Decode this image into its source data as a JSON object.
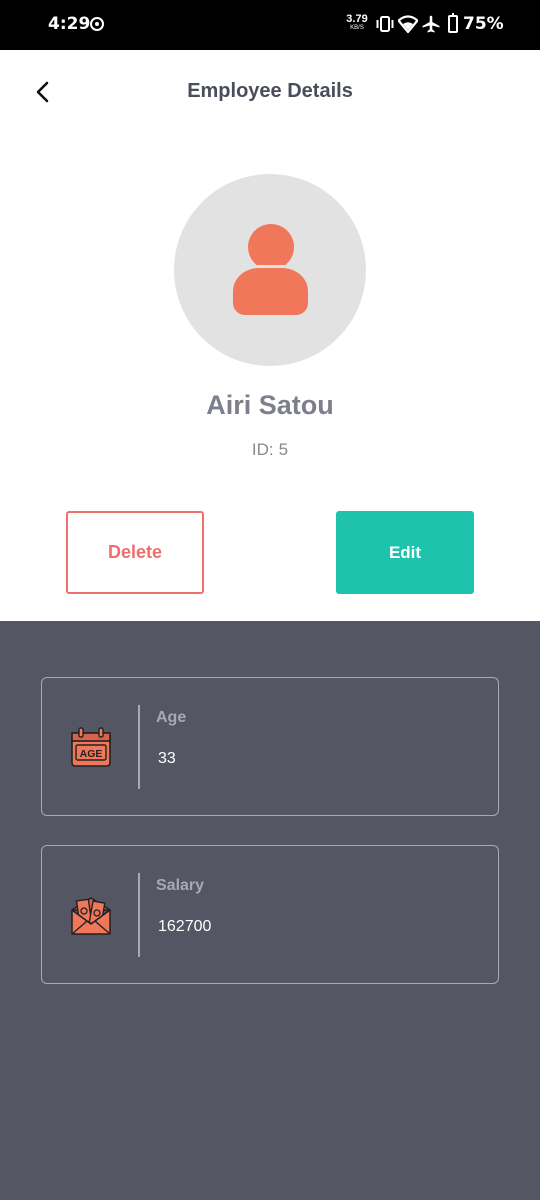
{
  "status_bar": {
    "time": "4:29",
    "net_speed_value": "3.79",
    "net_speed_unit": "KB/S",
    "battery": "75%"
  },
  "header": {
    "title": "Employee Details"
  },
  "employee": {
    "name": "Airi Satou",
    "id_prefix": "ID:",
    "id": "5"
  },
  "actions": {
    "delete_label": "Delete",
    "edit_label": "Edit"
  },
  "details": [
    {
      "label": "Age",
      "value": "33",
      "icon": "age-calendar-icon",
      "icon_text": "AGE"
    },
    {
      "label": "Salary",
      "value": "162700",
      "icon": "salary-envelope-icon"
    }
  ],
  "colors": {
    "accent_coral": "#f0775a",
    "delete_red": "#ef6f6f",
    "edit_teal": "#1ec3ae",
    "panel_bg": "#545664",
    "avatar_bg": "#e2e2e2"
  }
}
